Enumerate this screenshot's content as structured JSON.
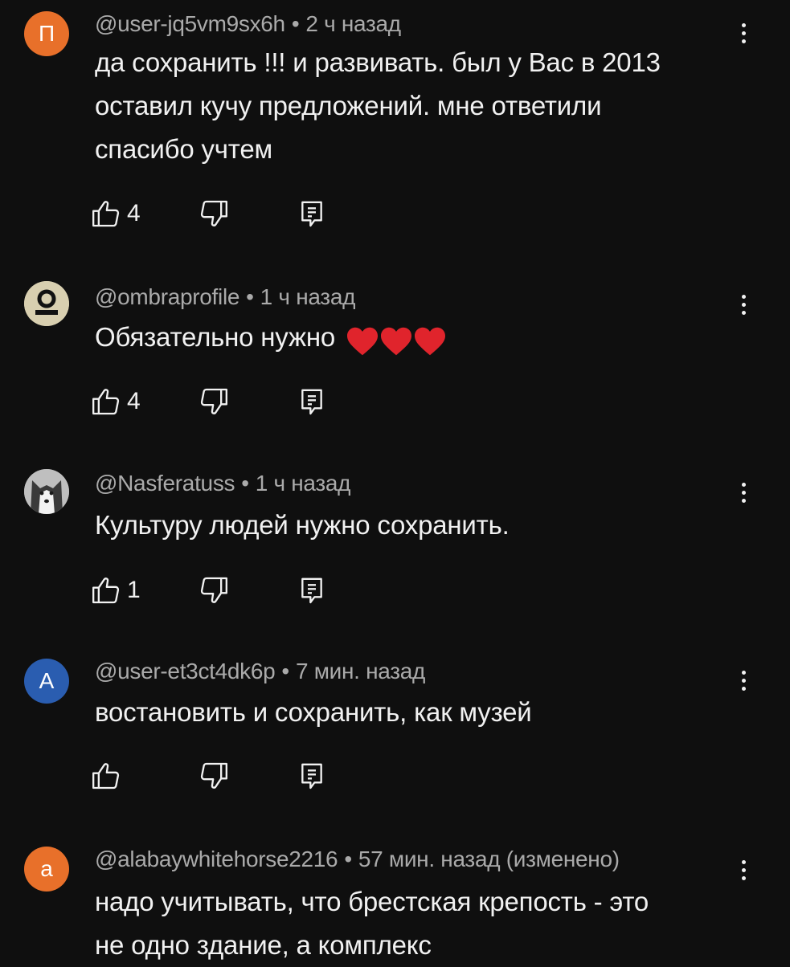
{
  "comments": [
    {
      "avatar_letter": "П",
      "avatar_color": "#e8702a",
      "author": "@user-jq5vm9sx6h",
      "time": "2 ч назад",
      "text_lines": [
        "да сохранить !!! и развивать. был у Вас в 2013",
        "оставил кучу предложений. мне ответили",
        "спасибо учтем"
      ],
      "likes": "4"
    },
    {
      "avatar_letter": "",
      "avatar_color": "#d8cfb0",
      "author": "@ombraprofile",
      "time": "1 ч назад",
      "text": "Обязательно нужно",
      "likes": "4"
    },
    {
      "avatar_letter": "",
      "avatar_color": "#8a8a8a",
      "author": "@Nasferatuss",
      "time": "1 ч назад",
      "text": "Культуру людей нужно сохранить.",
      "likes": "1"
    },
    {
      "avatar_letter": "A",
      "avatar_color": "#2a5db0",
      "author": "@user-et3ct4dk6p",
      "time": "7 мин. назад",
      "text": "востановить и сохранить, как музей",
      "likes": ""
    },
    {
      "avatar_letter": "a",
      "avatar_color": "#e8702a",
      "author": "@alabaywhitehorse2216",
      "time": "57 мин. назад (изменено)",
      "text_lines": [
        "надо учитывать, что брестская крепость  - это",
        "не одно здание, а комплекс"
      ],
      "likes": ""
    }
  ],
  "separator": "•",
  "icons": {
    "like": "thumbs-up-icon",
    "dislike": "thumbs-down-icon",
    "reply": "reply-icon",
    "menu": "more-vertical-icon",
    "heart": "red-heart-emoji"
  },
  "colors": {
    "background": "#0f0f0f",
    "text": "#f1f1f1",
    "meta": "#aaaaaa",
    "heart": "#e0242c"
  }
}
